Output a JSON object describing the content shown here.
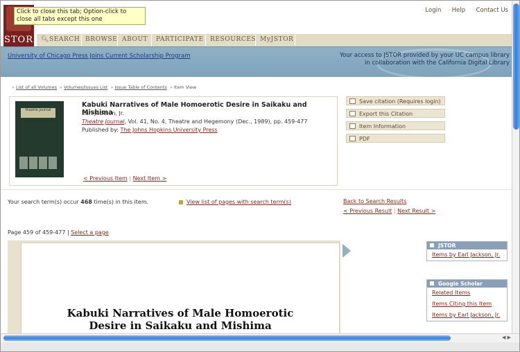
{
  "tooltip": "Click to close this tab; Option-click to close all tabs except this one",
  "brand": {
    "logo_text": "STOR"
  },
  "top_links": [
    "Login",
    "Help",
    "Contact Us"
  ],
  "nav": [
    "SEARCH",
    "BROWSE",
    "ABOUT",
    "PARTICIPATE",
    "RESOURCES",
    "MyJSTOR"
  ],
  "band": {
    "left_link": "University of Chicago Press Joins Current Scholarship Program",
    "right_line1": "Your access to JSTOR provided by your UC campus library",
    "right_line2": "in collaboration with the California Digital Library"
  },
  "breadcrumb": [
    "List of all Volumes",
    "Volumes/Issues List",
    "Issue Table of Contents",
    "Item View"
  ],
  "item": {
    "title": "Kabuki Narratives of Male Homoerotic Desire in Saikaku and Mishima",
    "author": "Earl Jackson, Jr.",
    "journal": "Theatre Journal",
    "citation_rest": ", Vol. 41, No. 4, Theatre and Hegemony (Dec., 1989), pp. 459-477",
    "published_label": "Published by: ",
    "publisher": "The Johns Hopkins University Press",
    "prev_item": "< Previous Item",
    "next_item": "Next Item >",
    "cover_title": "theatre journal"
  },
  "actions": [
    "Save citation (Requires login)",
    "Export this Citation",
    "Item Information",
    "PDF"
  ],
  "search": {
    "prefix": "Your search term(s) occur ",
    "count": "468",
    "suffix": " time(s) in this item.",
    "view_list": "View list of pages with search term(s)"
  },
  "results_nav": {
    "back": "Back to Search Results",
    "prev": "< Previous Result",
    "next": "Next Result >"
  },
  "page_info": {
    "text": "Page 459 of 459-477 | ",
    "select": "Select a page"
  },
  "page_title": {
    "line1": "Kabuki Narratives of Male Homoerotic",
    "line2": "Desire in Saikaku and Mishima"
  },
  "panels": {
    "jstor": {
      "header": "JSTOR",
      "links": [
        "Items by Earl Jackson, Jr."
      ]
    },
    "scholar": {
      "header": "Google Scholar",
      "links": [
        "Related Items",
        "Items Citing this Item",
        "Items by Earl Jackson, Jr."
      ]
    }
  },
  "colors": {
    "link": "#7a2a1e",
    "band": "#8fb1c7",
    "nav_bg": "#e3dcc4",
    "panel_header": "#8a9fb6",
    "scroll_thumb": "#3d7ed8"
  }
}
